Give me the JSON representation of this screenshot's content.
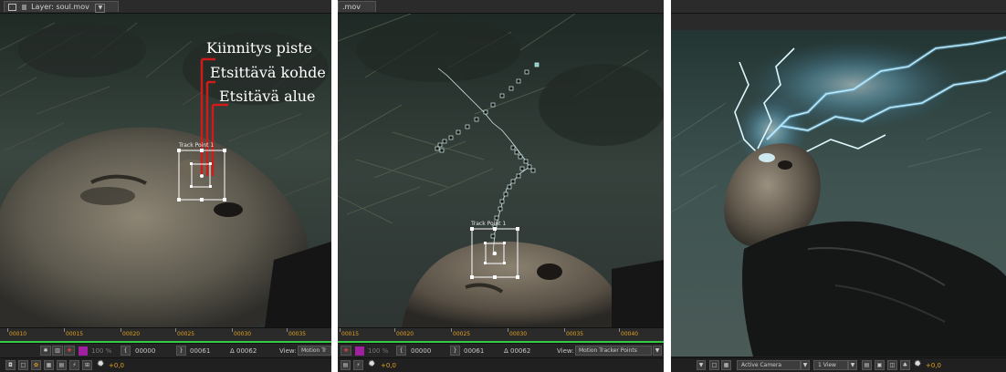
{
  "panel1": {
    "tab_label": "Layer: soul.mov",
    "annotations": {
      "attach_point": "Kiinnitys piste",
      "feature": "Etsittävä kohde",
      "search": "Etsitävä alue"
    },
    "track_name": "Track Point 1",
    "ruler": [
      "00010",
      "00015",
      "00020",
      "00025",
      "00030",
      "00035"
    ],
    "zoom": "100 %",
    "in_time": "00000",
    "out_time": "00061",
    "duration": "Δ 00062",
    "view_label": "View:",
    "view_value": "Motion Tr",
    "exposure": "+0,0"
  },
  "panel2": {
    "tab_label": ".mov",
    "track_name": "Track Point 1",
    "ruler": [
      "00015",
      "00020",
      "00025",
      "00030",
      "00035",
      "00040"
    ],
    "zoom": "100 %",
    "in_time": "00000",
    "out_time": "00061",
    "duration": "Δ 00062",
    "view_label": "View:",
    "view_value": "Motion Tracker Points",
    "exposure": "+0,0"
  },
  "panel3": {
    "camera": "Active Camera",
    "views": "1 View",
    "exposure": "+0,0"
  },
  "colors": {
    "annotation_line": "#d11a1a",
    "tracker_box": "#ffffff",
    "timecode_orange": "#e0a020",
    "timeline_green": "#33cc44"
  }
}
